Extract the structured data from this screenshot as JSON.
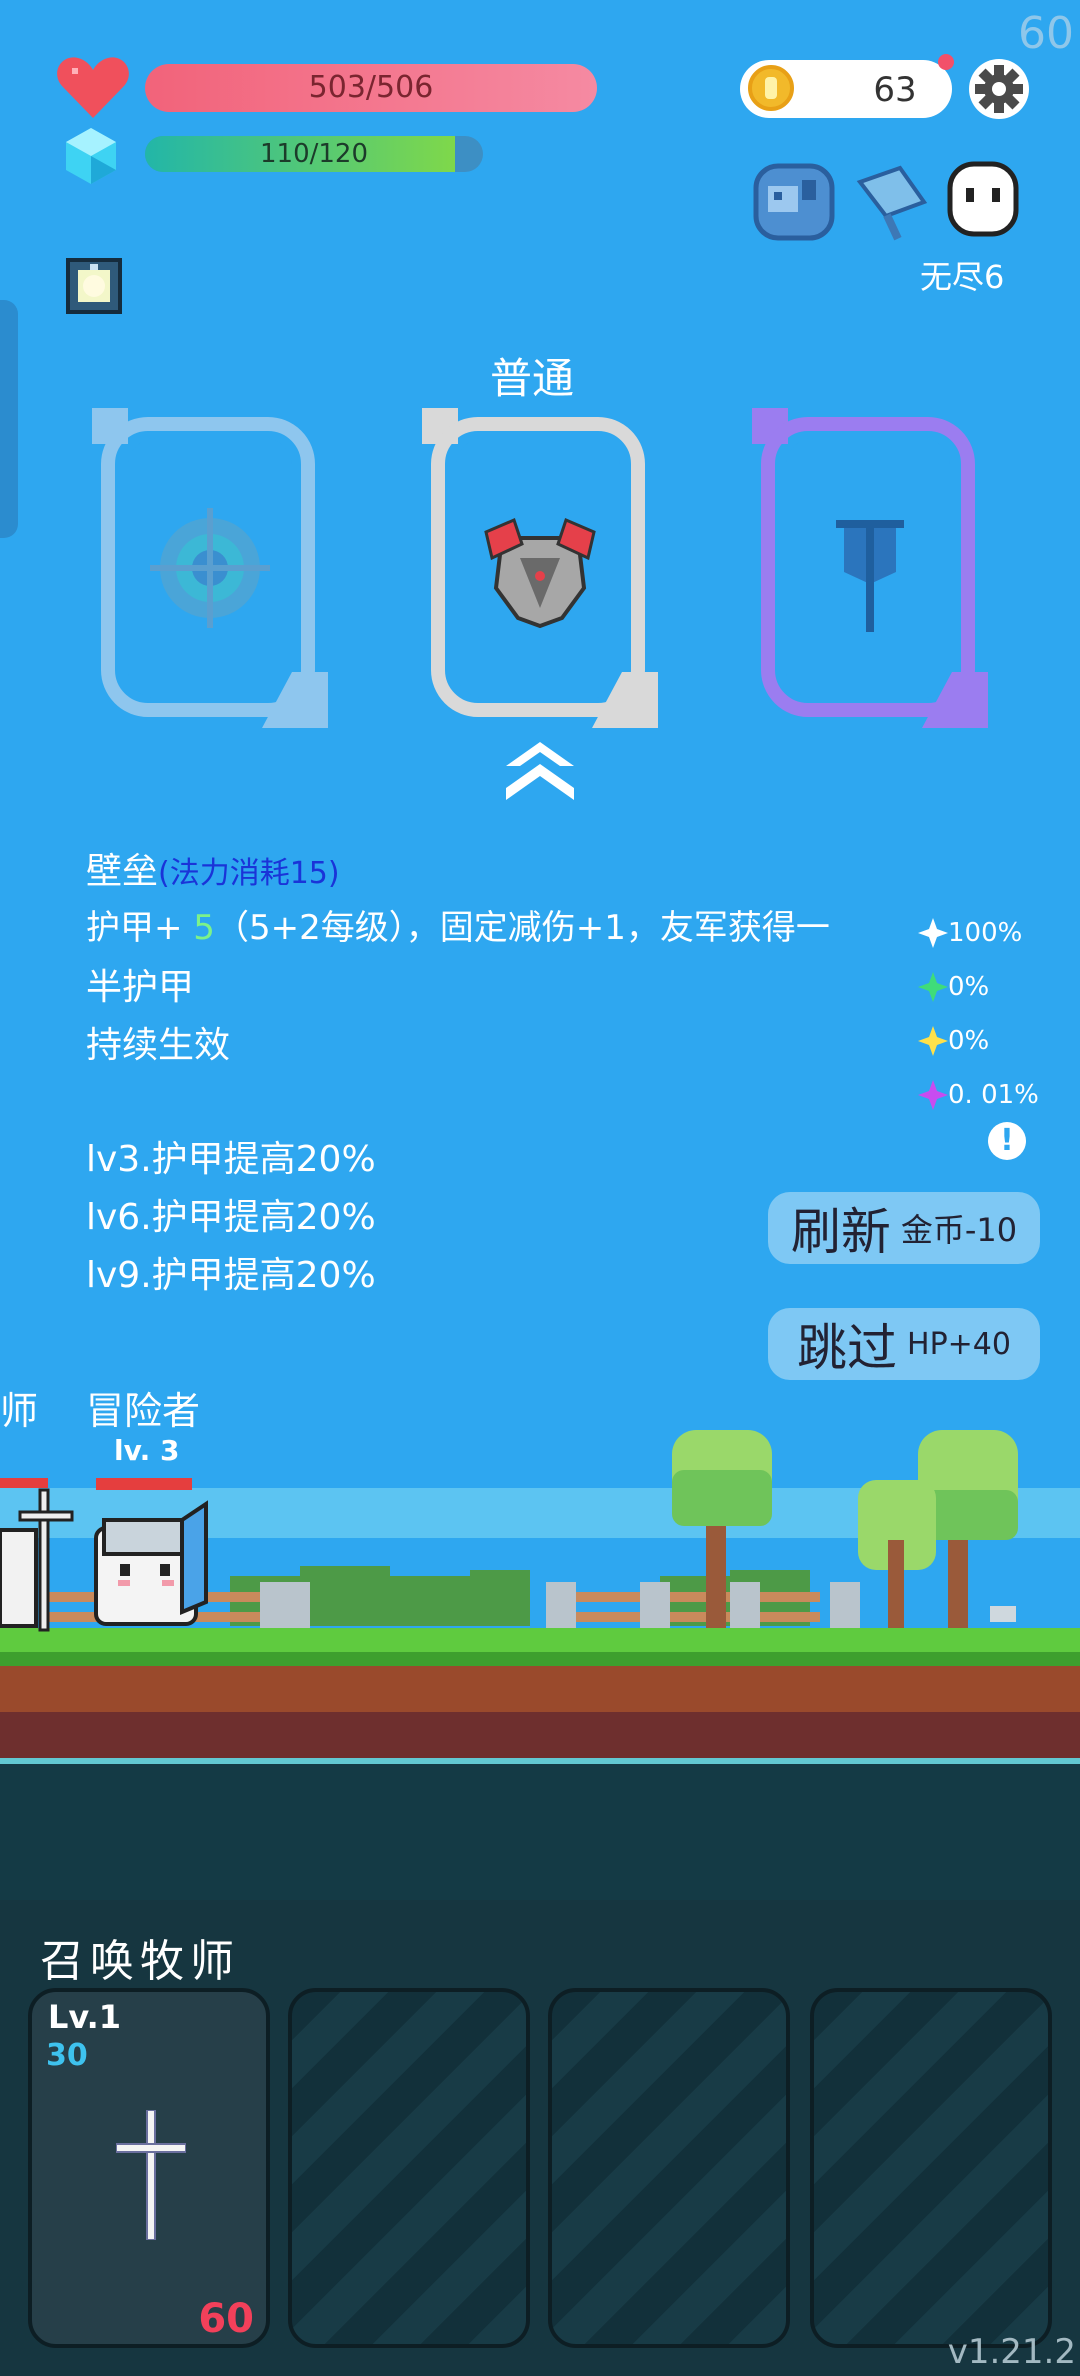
{
  "fps": "60",
  "hud": {
    "hp_text": "503/506",
    "hp_fraction": 0.994,
    "mp_text": "110/120",
    "mp_fraction": 0.917,
    "coins": "63",
    "endless_label": "无尽6"
  },
  "draft": {
    "rarity_label": "普通",
    "skill_name": "壁垒",
    "mana_cost": "(法力消耗15)",
    "desc_line1_prefix": "护甲+",
    "desc_line1_value": " 5",
    "desc_line1_suffix": "（5+2每级），固定减伤+1，友军获得一",
    "desc_line2": "半护甲",
    "desc_line3": "持续生效",
    "upgrades": [
      "lv3.护甲提高20%",
      "lv6.护甲提高20%",
      "lv9.护甲提高20%"
    ],
    "odds": [
      {
        "text": "100%",
        "color": "#ffffff"
      },
      {
        "text": "0%",
        "color": "#3fdc7a"
      },
      {
        "text": "0%",
        "color": "#ffe14a"
      },
      {
        "text": "0. 01%",
        "color": "#c84cf0"
      }
    ],
    "refresh_label": "刷新",
    "refresh_cost": "金币-10",
    "skip_label": "跳过",
    "skip_reward": "HP+40"
  },
  "battle": {
    "left_unit_name": "师",
    "hero_name": "冒险者",
    "hero_level": "lv. 3"
  },
  "summon": {
    "title": "召唤牧师",
    "card1_level": "Lv.1",
    "card1_value": "30",
    "card1_cost": "60"
  },
  "version": "v1.21.2"
}
